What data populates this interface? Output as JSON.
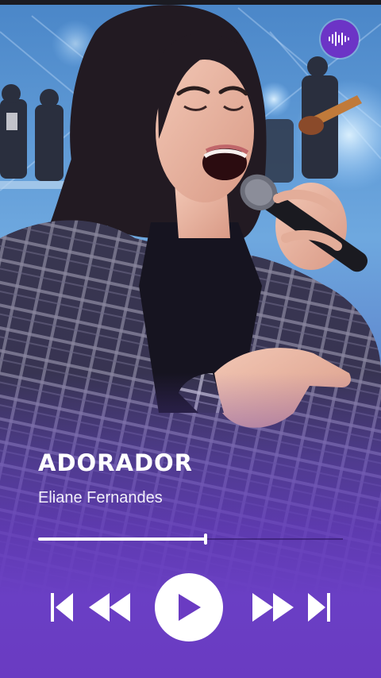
{
  "track": {
    "title": "ADORADOR",
    "artist": "Eliane Fernandes",
    "progress": 0.55
  },
  "icons": {
    "badge": "audio-waveform-icon",
    "skip_previous": "skip-previous-icon",
    "rewind": "rewind-icon",
    "play": "play-icon",
    "fast_forward": "fast-forward-icon",
    "skip_next": "skip-next-icon"
  },
  "colors": {
    "accent": "#6a3bc2",
    "badge": "#6c34c6",
    "foreground": "#ffffff"
  }
}
